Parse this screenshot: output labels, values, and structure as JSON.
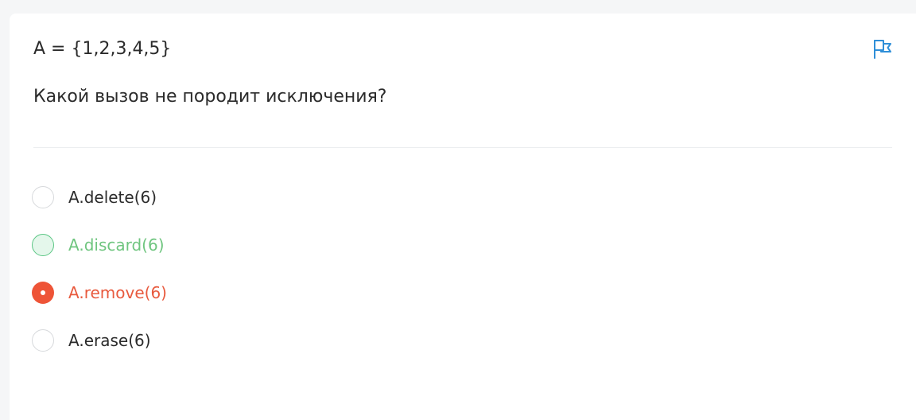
{
  "question": {
    "statement": "A = {1,2,3,4,5}",
    "prompt": "Какой вызов не породит исключения?",
    "flag_icon": "flag-icon"
  },
  "options": [
    {
      "label": "A.delete(6)",
      "state": "default"
    },
    {
      "label": "A.discard(6)",
      "state": "correct"
    },
    {
      "label": "A.remove(6)",
      "state": "selected-wrong"
    },
    {
      "label": "A.erase(6)",
      "state": "default"
    }
  ],
  "colors": {
    "correct": "#5cc685",
    "wrong": "#ee5437",
    "flag": "#2f8fd8"
  }
}
